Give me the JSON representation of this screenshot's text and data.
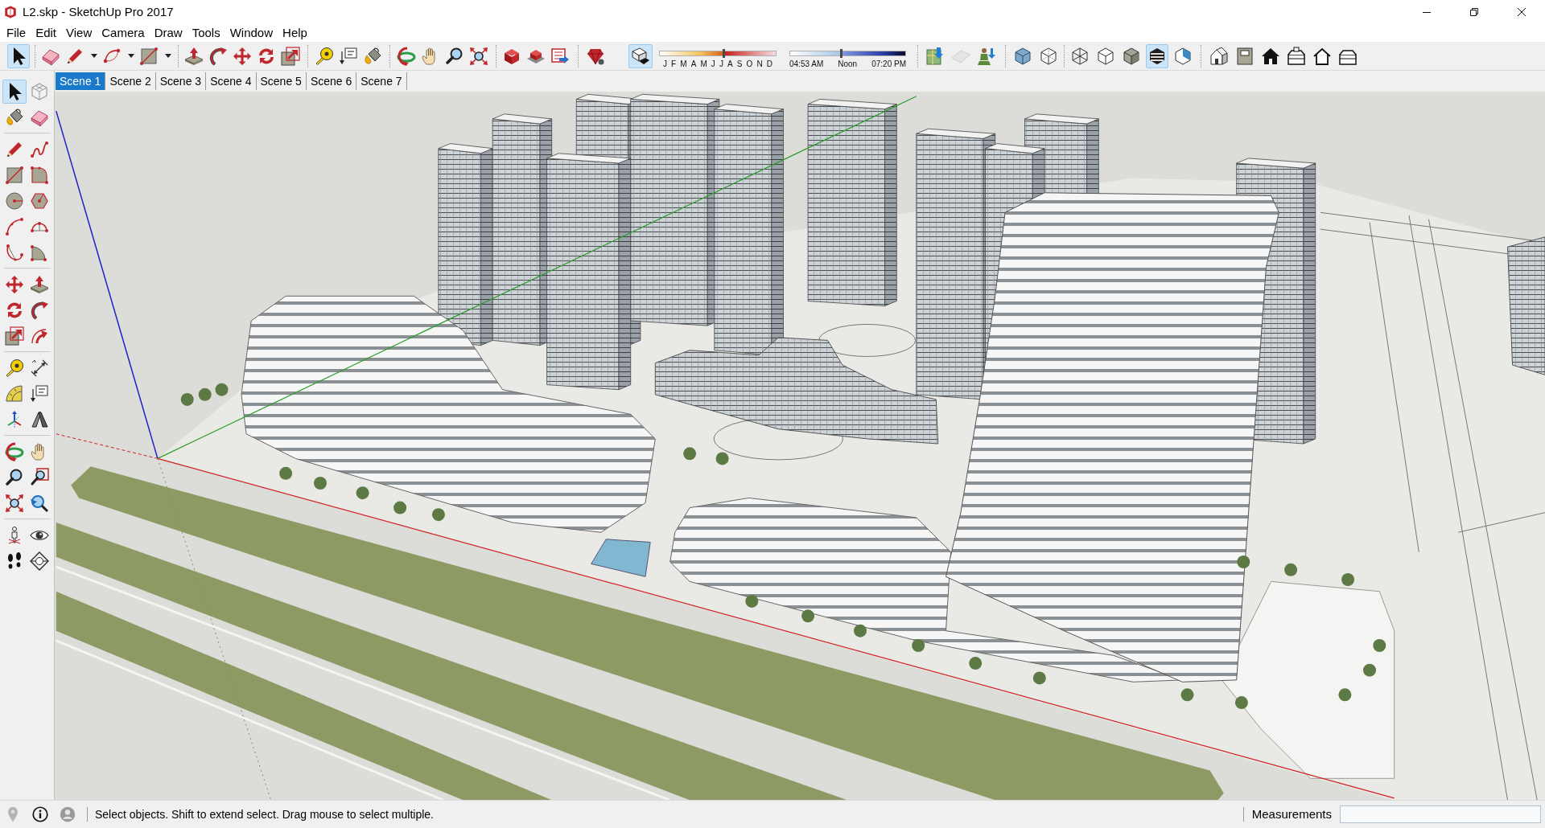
{
  "window": {
    "title": "L2.skp - SketchUp Pro 2017"
  },
  "menu_bar": [
    "File",
    "Edit",
    "View",
    "Camera",
    "Draw",
    "Tools",
    "Window",
    "Help"
  ],
  "toolbar": {
    "groups": [
      [
        {
          "kind": "button",
          "selected": true
        }
      ],
      [
        {
          "kind": "button",
          "selected": false
        },
        {
          "kind": "split",
          "selected": false
        },
        {
          "kind": "split",
          "selected": false
        },
        {
          "kind": "split",
          "selected": false
        }
      ],
      [
        {
          "kind": "button",
          "selected": false
        },
        {
          "kind": "button",
          "selected": false
        },
        {
          "kind": "button",
          "selected": false
        },
        {
          "kind": "button",
          "selected": false
        },
        {
          "kind": "button",
          "selected": false
        }
      ],
      [
        {
          "kind": "button",
          "selected": false
        },
        {
          "kind": "button",
          "selected": false
        },
        {
          "kind": "button",
          "selected": false
        }
      ],
      [
        {
          "kind": "button",
          "selected": false
        },
        {
          "kind": "button",
          "selected": false
        },
        {
          "kind": "button",
          "selected": false
        },
        {
          "kind": "button",
          "selected": false
        }
      ],
      [
        {
          "kind": "button",
          "selected": false
        },
        {
          "kind": "button",
          "selected": false
        },
        {
          "kind": "button",
          "selected": false
        }
      ],
      [
        {
          "kind": "button",
          "selected": false
        }
      ]
    ]
  },
  "shadows": {
    "toggle": {
      "on": true
    },
    "date_slider": {
      "labels": [
        "J",
        "F",
        "M",
        "A",
        "M",
        "J",
        "J",
        "A",
        "S",
        "O",
        "N",
        "D"
      ],
      "level": 0.55
    },
    "time_slider": {
      "labels": [
        "04:53 AM",
        "Noon",
        "07:20 PM"
      ],
      "level": 0.44
    }
  },
  "location_toolbar": [
    {
      "disabled": false
    },
    {
      "disabled": true
    },
    {
      "disabled": false
    }
  ],
  "styles_toolbar": [
    [
      {
        "on": false
      },
      {
        "on": false
      }
    ],
    [
      {
        "selected": false
      },
      {
        "selected": false
      },
      {
        "selected": false
      },
      {
        "selected": true
      },
      {
        "selected": false
      }
    ]
  ],
  "scene_tabs": [
    {
      "label": "Scene 1",
      "selected": true
    },
    {
      "label": "Scene 2",
      "selected": false
    },
    {
      "label": "Scene 3",
      "selected": false
    },
    {
      "label": "Scene 4",
      "selected": false
    },
    {
      "label": "Scene 5",
      "selected": false
    },
    {
      "label": "Scene 6",
      "selected": false
    },
    {
      "label": "Scene 7",
      "selected": false
    }
  ],
  "left_toolbar": {
    "groups": [
      [
        {
          "selected": true
        },
        {
          "selected": false
        },
        {
          "selected": false
        },
        {
          "selected": false
        }
      ],
      [
        {
          "selected": false
        },
        {
          "selected": false
        },
        {
          "selected": false
        },
        {
          "selected": false
        },
        {
          "selected": false
        },
        {
          "selected": false
        },
        {
          "selected": false
        },
        {
          "selected": false
        },
        {
          "selected": false
        },
        {
          "selected": false
        }
      ],
      [
        {
          "selected": false
        },
        {
          "selected": false
        },
        {
          "selected": false
        },
        {
          "selected": false
        },
        {
          "selected": false
        },
        {
          "selected": false
        }
      ],
      [
        {
          "selected": false
        },
        {
          "selected": false
        },
        {
          "selected": false
        },
        {
          "selected": false
        },
        {
          "selected": false
        },
        {
          "selected": false
        }
      ],
      [
        {
          "selected": false
        },
        {
          "selected": false
        },
        {
          "selected": false
        },
        {
          "selected": false
        },
        {
          "selected": false
        },
        {
          "selected": false
        }
      ],
      [
        {
          "selected": false
        },
        {
          "selected": false
        },
        {
          "selected": false
        },
        {
          "selected": false
        }
      ]
    ]
  },
  "status_bar": {
    "message": "Select objects. Shift to extend select. Drag mouse to select multiple.",
    "measurements_label": "Measurements"
  }
}
